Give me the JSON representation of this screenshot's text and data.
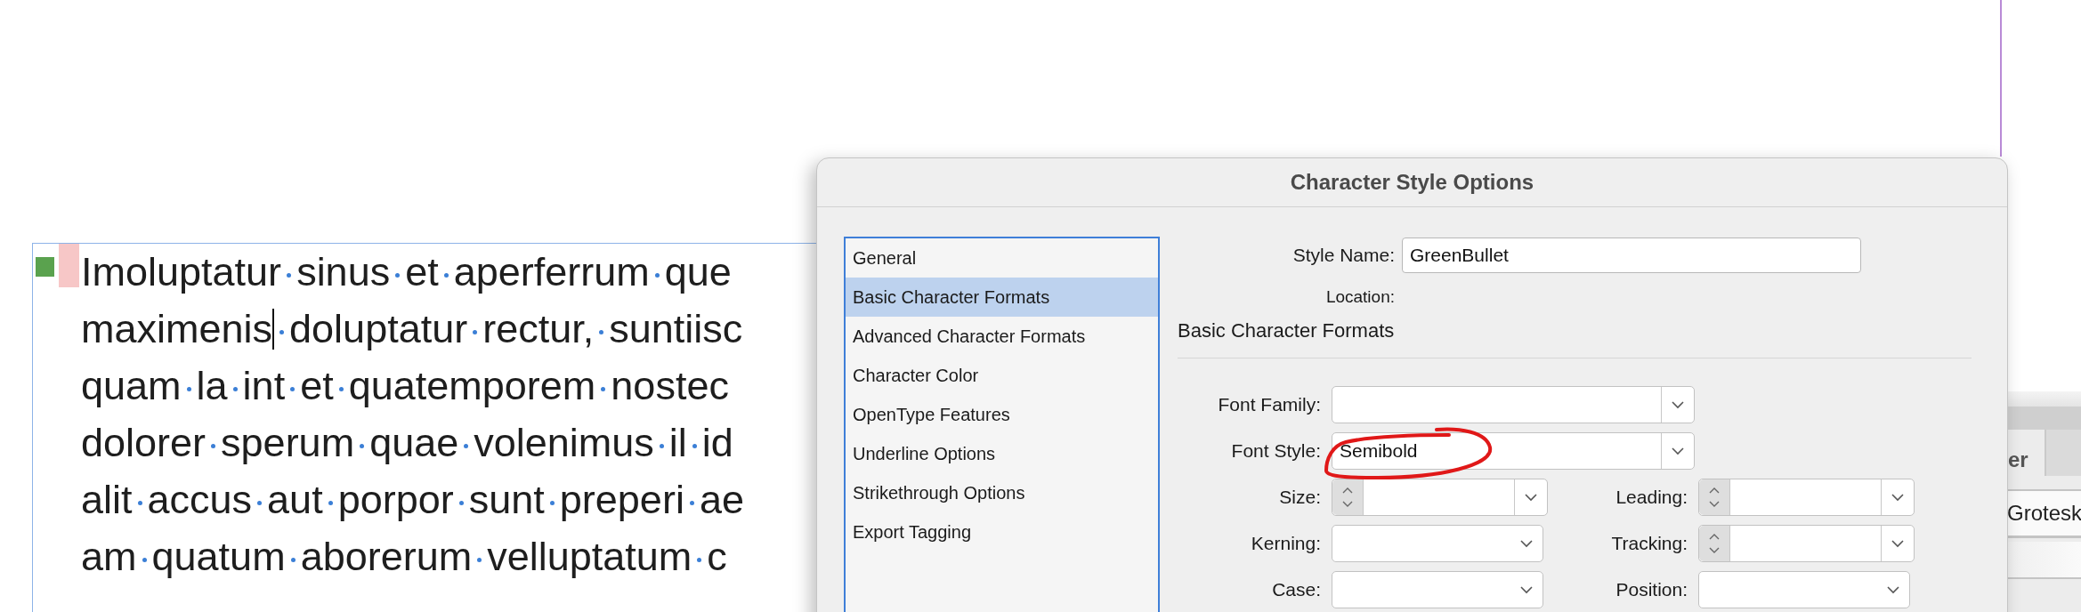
{
  "document": {
    "lines": [
      {
        "text": "Imoluptatur sinus et aperferrum que",
        "bullet": true
      },
      {
        "text": "maximenis",
        "caret": true,
        "rest": "doluptatur rectur, suntiisc"
      },
      {
        "text": "quam la int et quatemporem nostec"
      },
      {
        "text": "dolorer sperum quae volenimus il id"
      },
      {
        "text": "alit accus aut porpor sunt preperi ae"
      },
      {
        "text": "am quatum aborerum velluptatum c"
      }
    ]
  },
  "dialog": {
    "title": "Character Style Options",
    "categories": [
      {
        "label": "General",
        "selected": false
      },
      {
        "label": "Basic Character Formats",
        "selected": true
      },
      {
        "label": "Advanced Character Formats",
        "selected": false
      },
      {
        "label": "Character Color",
        "selected": false
      },
      {
        "label": "OpenType Features",
        "selected": false
      },
      {
        "label": "Underline Options",
        "selected": false
      },
      {
        "label": "Strikethrough Options",
        "selected": false
      },
      {
        "label": "Export Tagging",
        "selected": false
      }
    ],
    "style_name": {
      "label": "Style Name:",
      "value": "GreenBullet"
    },
    "location_label": "Location:",
    "section_title": "Basic Character Formats",
    "rows": [
      [
        {
          "label": "Font Family:",
          "kind": "combo"
        }
      ],
      [
        {
          "label": "Font Style:",
          "kind": "combo",
          "value": "Semibold"
        }
      ],
      [
        {
          "label": "Size:",
          "kind": "stepper"
        },
        {
          "label": "Leading:",
          "kind": "stepper"
        }
      ],
      [
        {
          "label": "Kerning:",
          "kind": "dropdown"
        },
        {
          "label": "Tracking:",
          "kind": "stepper"
        }
      ],
      [
        {
          "label": "Case:",
          "kind": "dropdown"
        },
        {
          "label": "Position:",
          "kind": "dropdown"
        }
      ]
    ]
  },
  "background_panel": {
    "tab_label": "er",
    "font_value": "Grotesk"
  }
}
